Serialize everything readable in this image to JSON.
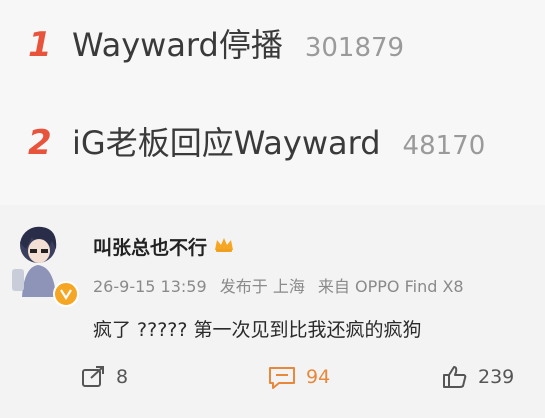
{
  "trending": [
    {
      "rank": "1",
      "title": "Wayward停播",
      "count": "301879"
    },
    {
      "rank": "2",
      "title": "iG老板回应Wayward",
      "count": "48170"
    }
  ],
  "comment": {
    "username": "叫张总也不行",
    "date": "26-9-15 13:59",
    "posted_from": "发布于 上海",
    "device": "来自 OPPO Find X8",
    "text": "疯了 ????? 第一次见到比我还疯的疯狗",
    "actions": {
      "repost_count": "8",
      "comment_count": "94",
      "like_count": "239"
    }
  },
  "colors": {
    "rank": "#e8543b",
    "comment_accent": "#e8883b",
    "vip_badge": "#f5a623"
  },
  "icons": [
    "crown-icon",
    "vip-badge-icon",
    "repost-icon",
    "comment-icon",
    "like-icon"
  ]
}
